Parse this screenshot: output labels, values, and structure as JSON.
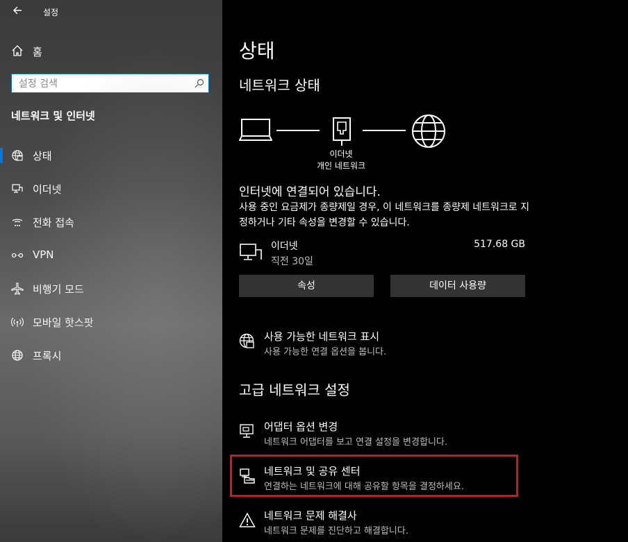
{
  "window": {
    "title": "설정"
  },
  "sidebar": {
    "home_label": "홈",
    "search_placeholder": "설정 검색",
    "section_title": "네트워크 및 인터넷",
    "items": [
      {
        "label": "상태",
        "icon": "globe-grid-icon",
        "selected": true
      },
      {
        "label": "이더넷",
        "icon": "ethernet-monitor-icon",
        "selected": false
      },
      {
        "label": "전화 접속",
        "icon": "dialup-icon",
        "selected": false
      },
      {
        "label": "VPN",
        "icon": "vpn-icon",
        "selected": false
      },
      {
        "label": "비행기 모드",
        "icon": "airplane-icon",
        "selected": false
      },
      {
        "label": "모바일 핫스팟",
        "icon": "hotspot-icon",
        "selected": false
      },
      {
        "label": "프록시",
        "icon": "globe-icon",
        "selected": false
      }
    ]
  },
  "main": {
    "title": "상태",
    "network_status_heading": "네트워크 상태",
    "diagram": {
      "line1": "이더넷",
      "line2": "개인 네트워크"
    },
    "connected_text": "인터넷에 연결되어 있습니다.",
    "description": "사용 중인 요금제가 종량제일 경우, 이 네트워크를 종량제 네트워크로 지정하거나 기타 속성을 변경할 수 있습니다.",
    "connection": {
      "name": "이더넷",
      "period": "직전 30일",
      "usage": "517.68 GB"
    },
    "buttons": {
      "properties": "속성",
      "data_usage": "데이터 사용량"
    },
    "available_networks": {
      "title": "사용 가능한 네트워크 표시",
      "desc": "사용 가능한 연결 옵션을 봅니다."
    },
    "advanced_heading": "고급 네트워크 설정",
    "advanced_items": [
      {
        "title": "어댑터 옵션 변경",
        "desc": "네트워크 어댑터를 보고 연결 설정을 변경합니다.",
        "icon": "adapter-icon"
      },
      {
        "title": "네트워크 및 공유 센터",
        "desc": "연결하는 네트워크에 대해 공유할 항목을 결정하세요.",
        "icon": "sharing-center-icon"
      },
      {
        "title": "네트워크 문제 해결사",
        "desc": "네트워크 문제를 진단하고 해결합니다.",
        "icon": "warning-icon"
      }
    ]
  },
  "colors": {
    "accent": "#0078d7",
    "highlight": "#e0101e",
    "button_bg": "#333333"
  }
}
